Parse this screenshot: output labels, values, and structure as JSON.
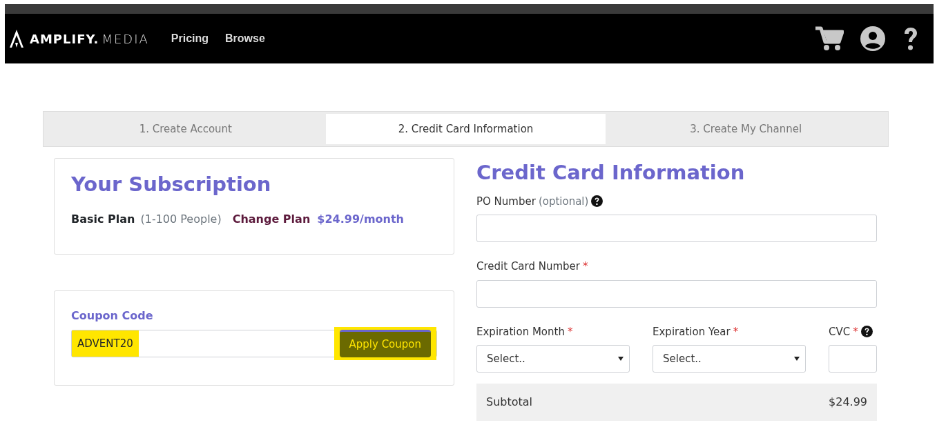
{
  "navbar": {
    "logo_bold": "AMPLIFY.",
    "logo_light": "MEDIA",
    "links": [
      "Pricing",
      "Browse"
    ]
  },
  "steps": [
    {
      "label": "1. Create Account",
      "selected": false
    },
    {
      "label": "2. Credit Card Information",
      "selected": true
    },
    {
      "label": "3. Create My Channel",
      "selected": false
    }
  ],
  "subscription": {
    "title": "Your Subscription",
    "plan": "Basic Plan",
    "people": "(1-100 People)",
    "change_link": "Change Plan",
    "price": "$24.99/month"
  },
  "coupon": {
    "label": "Coupon Code",
    "value": "ADVENT20",
    "button": "Apply Coupon",
    "highlighted": true
  },
  "credit_card": {
    "title": "Credit Card Information",
    "po": {
      "label": "PO Number",
      "optional": "(optional)"
    },
    "card_number": {
      "label": "Credit Card Number",
      "required": "*"
    },
    "month": {
      "label": "Expiration Month",
      "required": "*",
      "value": "Select.."
    },
    "year": {
      "label": "Expiration Year",
      "required": "*",
      "value": "Select.."
    },
    "cvc": {
      "label": "CVC",
      "required": "*"
    },
    "totals": [
      {
        "label": "Subtotal",
        "value": "$24.99"
      }
    ]
  }
}
